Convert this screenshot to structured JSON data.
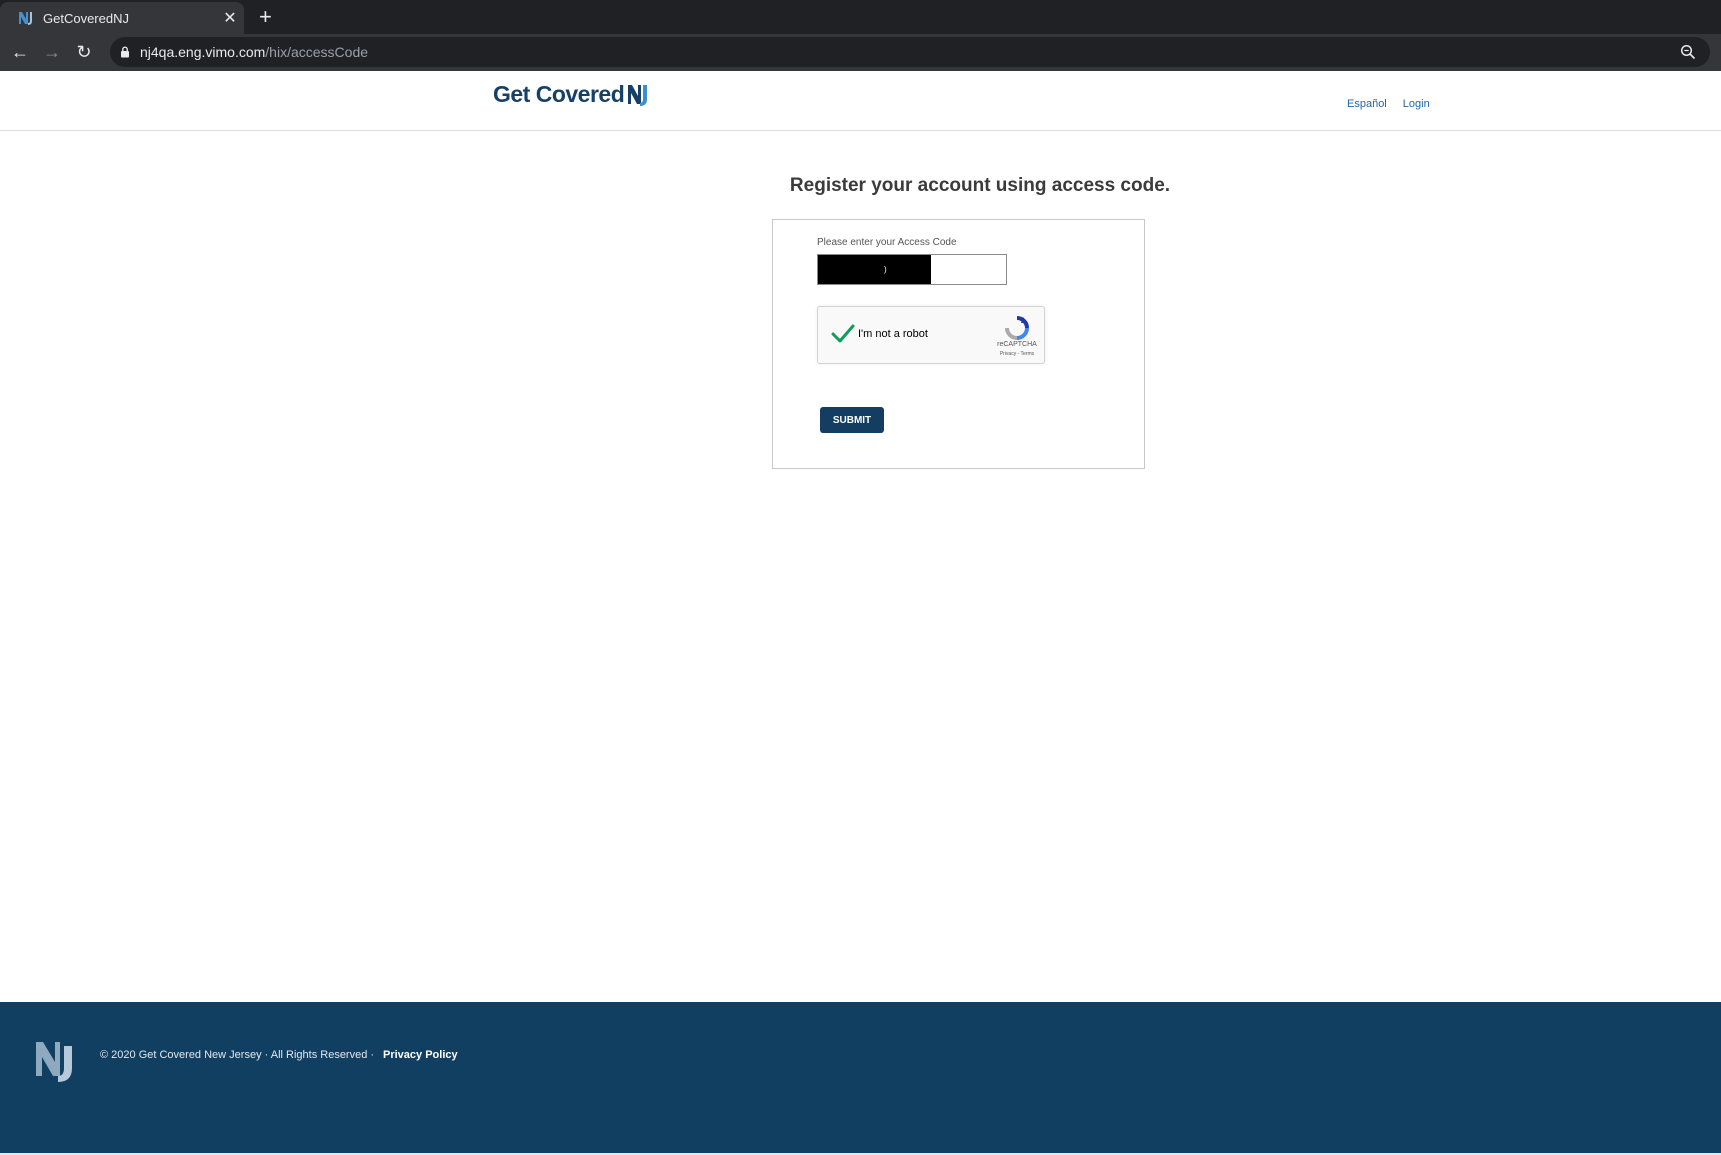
{
  "browser": {
    "tab_title": "GetCoveredNJ",
    "tab_close": "✕",
    "new_tab": "+",
    "url_host": "nj4qa.eng.vimo.com",
    "url_path": "/hix/accessCode",
    "back": "←",
    "forward": "→",
    "reload": "↻"
  },
  "header": {
    "logo_text": "Get Covered",
    "links": {
      "espanol": "Español",
      "login": "Login"
    }
  },
  "main": {
    "title": "Register your account using access code.",
    "access_code_label": "Please enter your Access Code",
    "access_code_value": ")",
    "captcha": {
      "label": "I'm not a robot",
      "brand": "reCAPTCHA",
      "links": "Privacy - Terms",
      "checked": true
    },
    "submit_label": "SUBMIT"
  },
  "footer": {
    "copyright": "© 2020 Get Covered New Jersey · All Rights Reserved ·",
    "privacy_label": "Privacy Policy"
  },
  "colors": {
    "brand_navy": "#143e61",
    "footer_bg": "#113f61",
    "link_blue": "#1f66a7",
    "check_green": "#0f9d58"
  }
}
